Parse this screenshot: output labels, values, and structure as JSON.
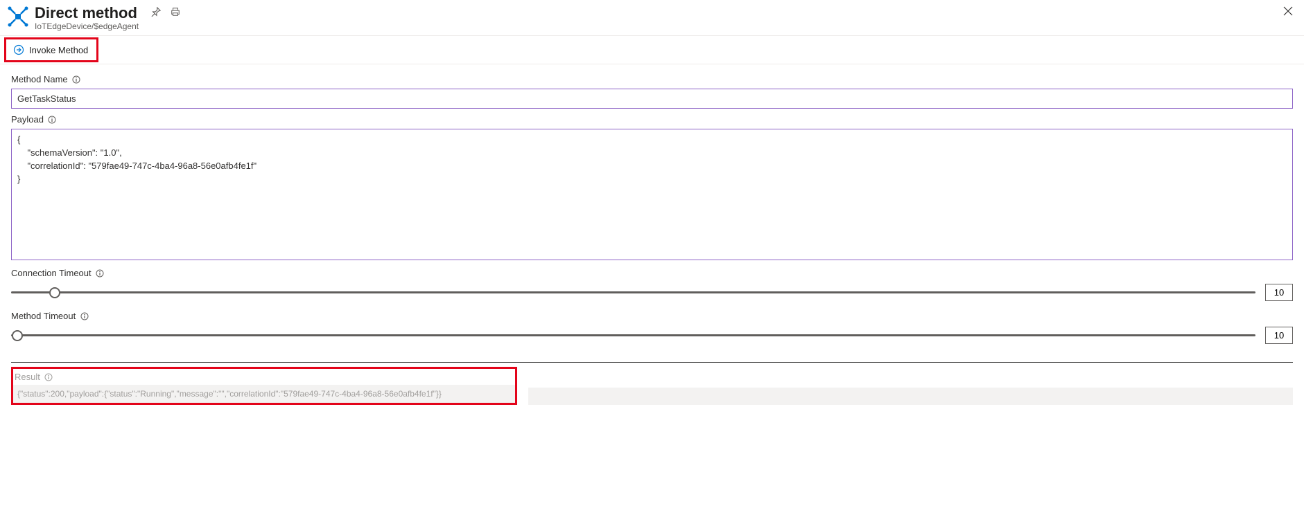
{
  "header": {
    "title": "Direct method",
    "subtitle": "IoTEdgeDevice/$edgeAgent",
    "pin_icon": "pin-icon",
    "print_icon": "print-icon",
    "close_icon": "close-icon"
  },
  "toolbar": {
    "invoke_label": "Invoke Method"
  },
  "fields": {
    "method_name_label": "Method Name",
    "method_name_value": "GetTaskStatus",
    "payload_label": "Payload",
    "payload_value": "{\n    \"schemaVersion\": \"1.0\",\n    \"correlationId\": \"579fae49-747c-4ba4-96a8-56e0afb4fe1f\"\n}",
    "connection_timeout_label": "Connection Timeout",
    "connection_timeout_value": "10",
    "method_timeout_label": "Method Timeout",
    "method_timeout_value": "10",
    "result_label": "Result",
    "result_value": "{\"status\":200,\"payload\":{\"status\":\"Running\",\"message\":\"\",\"correlationId\":\"579fae49-747c-4ba4-96a8-56e0afb4fe1f\"}}"
  },
  "sliders": {
    "connection_thumb_percent": 3.5,
    "method_thumb_percent": 0.5
  }
}
